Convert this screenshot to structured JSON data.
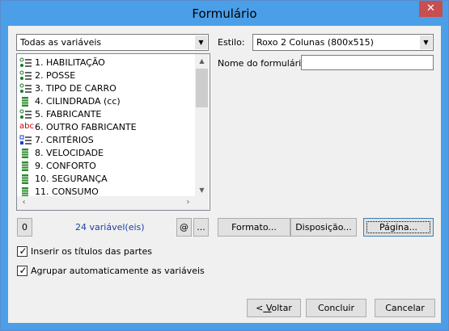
{
  "window": {
    "title": "Formulário",
    "close_label": "✕"
  },
  "variables_filter": {
    "value": "Todas as variáveis"
  },
  "variables": [
    {
      "label": "1. HABILITAÇÃO",
      "type": "single-choice"
    },
    {
      "label": "2. POSSE",
      "type": "single-choice"
    },
    {
      "label": "3. TIPO DE CARRO",
      "type": "single-choice"
    },
    {
      "label": "4. CILINDRADA (cc)",
      "type": "numeric"
    },
    {
      "label": "5. FABRICANTE",
      "type": "single-choice"
    },
    {
      "label": "6. OUTRO FABRICANTE",
      "type": "text",
      "icon_text": "abc"
    },
    {
      "label": "7. CRITÉRIOS",
      "type": "multi-choice"
    },
    {
      "label": "8. VELOCIDADE",
      "type": "numeric"
    },
    {
      "label": "9. CONFORTO",
      "type": "numeric"
    },
    {
      "label": "10. SEGURANÇA",
      "type": "numeric"
    },
    {
      "label": "11. CONSUMO",
      "type": "numeric"
    }
  ],
  "style": {
    "label": "Estilo:",
    "value": "Roxo 2 Colunas (800x515)"
  },
  "form_name": {
    "label": "Nome do formulário:",
    "value": ""
  },
  "counter": {
    "button_label": "0",
    "text": "24 variável(eis)"
  },
  "small_buttons": {
    "at_label": "@",
    "more_label": "..."
  },
  "action_buttons": {
    "format": "Formato...",
    "layout": "Disposição...",
    "page": "Página..."
  },
  "options": {
    "insert_titles": {
      "label": "Inserir os títulos das partes",
      "checked": true
    },
    "group_vars": {
      "label": "Agrupar automaticamente as variáveis",
      "checked": true
    }
  },
  "footer": {
    "back_prefix": "<",
    "back_underlined": " V",
    "back_rest": "oltar",
    "finish": "Concluir",
    "cancel": "Cancelar"
  },
  "icons": {
    "dropdown": "chevron-down-icon",
    "scroll_up": "scroll-up-icon",
    "scroll_down": "scroll-down-icon",
    "scroll_left": "scroll-left-icon",
    "scroll_right": "scroll-right-icon"
  },
  "colors": {
    "title_bar": "#4a9fe8",
    "close_button": "#c74f4f",
    "counter_text": "#1a3fa6",
    "single_choice_icon": "#1a7a2a",
    "numeric_icon": "#2e8b2e",
    "text_icon": "#cc0000",
    "multi_choice_icon": "#1a3fcc"
  }
}
